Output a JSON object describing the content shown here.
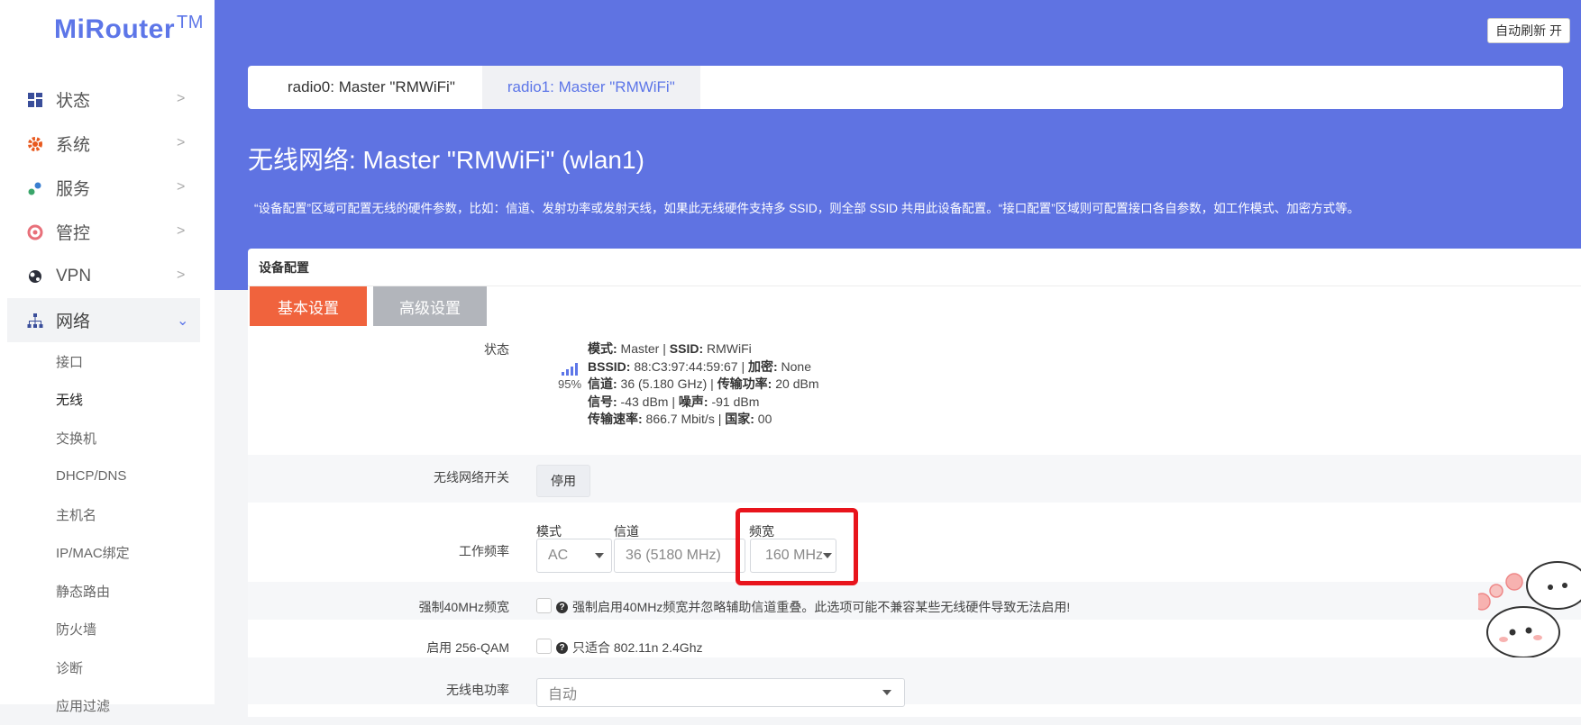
{
  "logo": {
    "text": "MiRouter",
    "tm": "TM"
  },
  "nav": [
    {
      "label": "状态",
      "icon": "dashboard-icon"
    },
    {
      "label": "系统",
      "icon": "gear-icon"
    },
    {
      "label": "服务",
      "icon": "services-icon"
    },
    {
      "label": "管控",
      "icon": "control-icon"
    },
    {
      "label": "VPN",
      "icon": "globe-icon"
    },
    {
      "label": "网络",
      "icon": "network-icon"
    }
  ],
  "subnav": [
    "接口",
    "无线",
    "交换机",
    "DHCP/DNS",
    "主机名",
    "IP/MAC绑定",
    "静态路由",
    "防火墙",
    "诊断",
    "应用过滤"
  ],
  "header": {
    "auto_refresh": "自动刷新 开"
  },
  "tabs": [
    "radio0: Master \"RMWiFi\"",
    "radio1: Master \"RMWiFi\""
  ],
  "page": {
    "title": "无线网络: Master \"RMWiFi\" (wlan1)",
    "description": "“设备配置”区域可配置无线的硬件参数，比如：信道、发射功率或发射天线，如果此无线硬件支持多 SSID，则全部 SSID 共用此设备配置。“接口配置”区域则可配置接口各自参数，如工作模式、加密方式等。"
  },
  "card": {
    "title": "设备配置",
    "subtabs": [
      "基本设置",
      "高级设置"
    ]
  },
  "status": {
    "label": "状态",
    "signal_pct": "95%",
    "line1_mode_k": "模式:",
    "line1_mode_v": " Master | ",
    "line1_ssid_k": "SSID:",
    "line1_ssid_v": " RMWiFi",
    "line2_bssid_k": "BSSID:",
    "line2_bssid_v": " 88:C3:97:44:59:67 | ",
    "line2_enc_k": "加密:",
    "line2_enc_v": " None",
    "line3_ch_k": "信道:",
    "line3_ch_v": " 36 (5.180 GHz) | ",
    "line3_tx_k": "传输功率:",
    "line3_tx_v": " 20 dBm",
    "line4_sig_k": "信号:",
    "line4_sig_v": " -43 dBm | ",
    "line4_noise_k": "噪声:",
    "line4_noise_v": " -91 dBm",
    "line5_rate_k": "传输速率:",
    "line5_rate_v": " 866.7 Mbit/s | ",
    "line5_country_k": "国家:",
    "line5_country_v": " 00"
  },
  "wireless_switch": {
    "label": "无线网络开关",
    "button": "停用"
  },
  "frequency": {
    "label": "工作频率",
    "mode_label": "模式",
    "mode_value": "AC",
    "channel_label": "信道",
    "channel_value": "36 (5180 MHz)",
    "width_label": "频宽",
    "width_value": "160 MHz"
  },
  "force40": {
    "label": "强制40MHz频宽",
    "hint": "强制启用40MHz频宽并忽略辅助信道重叠。此选项可能不兼容某些无线硬件导致无法启用!"
  },
  "qam256": {
    "label": "启用 256-QAM",
    "hint": "只适合 802.11n 2.4Ghz"
  },
  "txpower": {
    "label": "无线电功率",
    "value": "自动"
  },
  "colors": {
    "accent": "#5f73e2",
    "basic_tab": "#f0633d",
    "highlight": "#e8141c"
  }
}
